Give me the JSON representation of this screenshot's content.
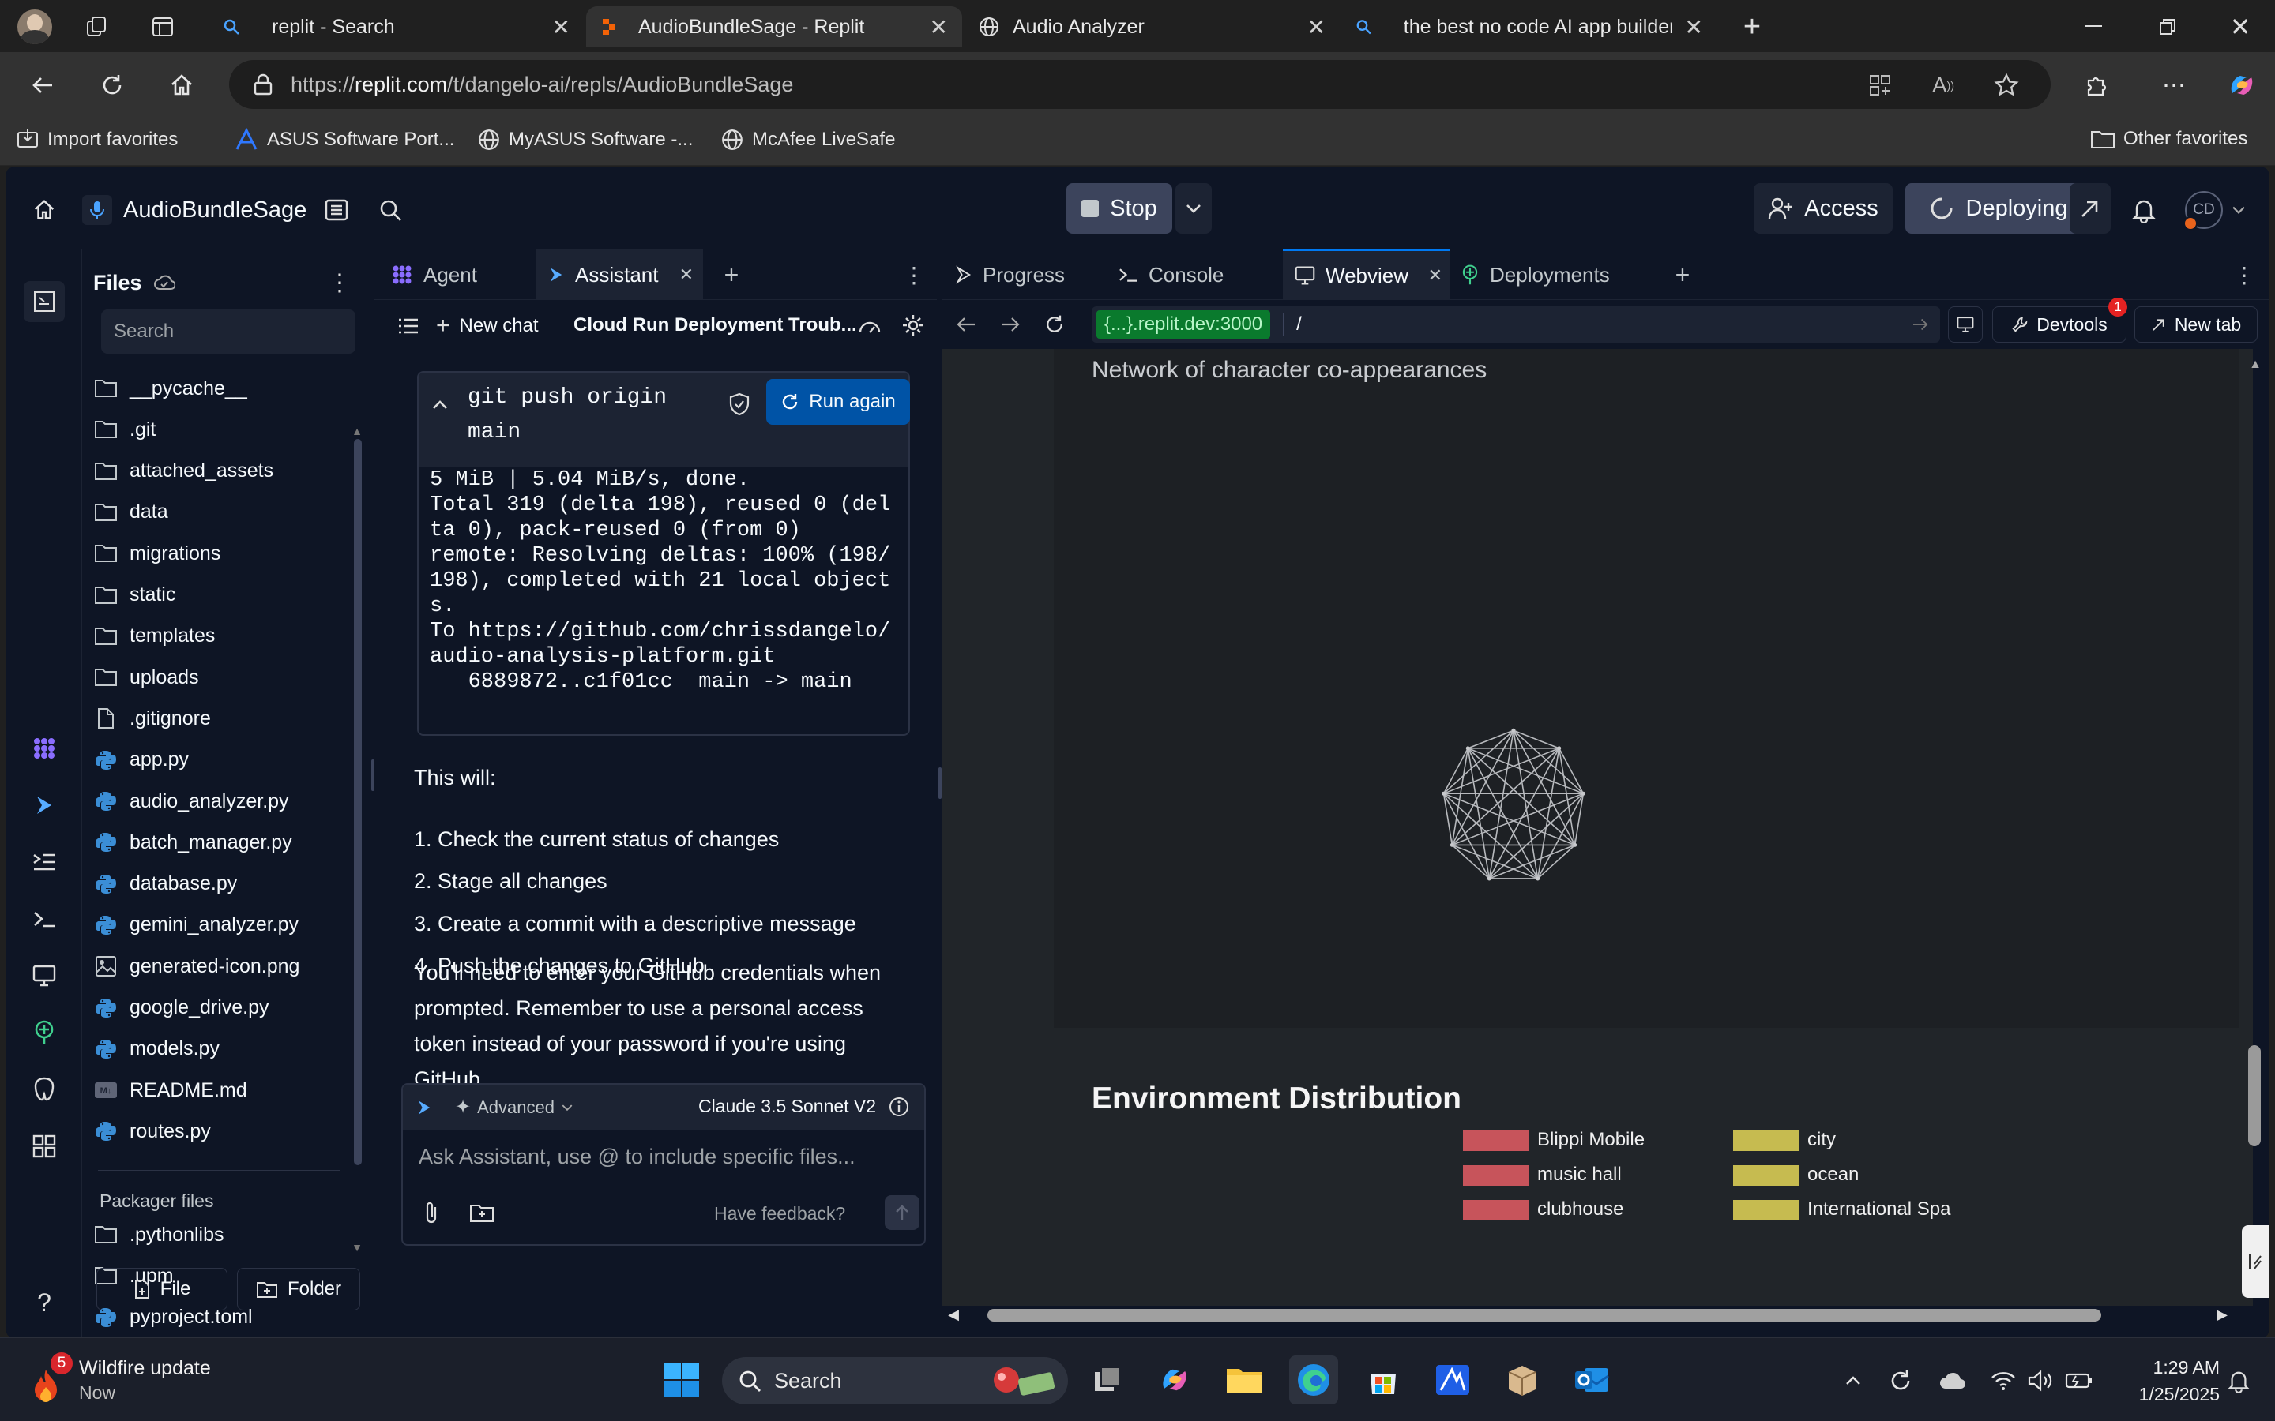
{
  "browser": {
    "tabs": [
      {
        "label": "replit - Search"
      },
      {
        "label": "AudioBundleSage - Replit"
      },
      {
        "label": "Audio Analyzer"
      },
      {
        "label": "the best no code AI app builder -"
      }
    ],
    "url_prefix": "https://",
    "url_host": "replit.com",
    "url_path": "/t/dangelo-ai/repls/AudioBundleSage",
    "favorites": [
      {
        "label": "Import favorites"
      },
      {
        "label": "ASUS Software Port..."
      },
      {
        "label": "MyASUS Software -..."
      },
      {
        "label": "McAfee LiveSafe"
      }
    ],
    "other_favorites": "Other favorites"
  },
  "app": {
    "repl_name": "AudioBundleSage",
    "stop_label": "Stop",
    "access_label": "Access",
    "deploying_label": "Deploying",
    "avatar_initials": "CD"
  },
  "files": {
    "title": "Files",
    "search_placeholder": "Search",
    "items": [
      {
        "name": "__pycache__",
        "icon": "folder"
      },
      {
        "name": ".git",
        "icon": "folder"
      },
      {
        "name": "attached_assets",
        "icon": "folder"
      },
      {
        "name": "data",
        "icon": "folder"
      },
      {
        "name": "migrations",
        "icon": "folder"
      },
      {
        "name": "static",
        "icon": "folder"
      },
      {
        "name": "templates",
        "icon": "folder"
      },
      {
        "name": "uploads",
        "icon": "folder"
      },
      {
        "name": ".gitignore",
        "icon": "file"
      },
      {
        "name": "app.py",
        "icon": "python"
      },
      {
        "name": "audio_analyzer.py",
        "icon": "python"
      },
      {
        "name": "batch_manager.py",
        "icon": "python"
      },
      {
        "name": "database.py",
        "icon": "python"
      },
      {
        "name": "gemini_analyzer.py",
        "icon": "python"
      },
      {
        "name": "generated-icon.png",
        "icon": "image"
      },
      {
        "name": "google_drive.py",
        "icon": "python"
      },
      {
        "name": "models.py",
        "icon": "python"
      },
      {
        "name": "README.md",
        "icon": "markdown"
      },
      {
        "name": "routes.py",
        "icon": "python"
      }
    ],
    "packager_title": "Packager files",
    "packager_items": [
      {
        "name": ".pythonlibs",
        "icon": "folder"
      },
      {
        "name": ".upm",
        "icon": "folder"
      },
      {
        "name": "pyproject.toml",
        "icon": "python"
      }
    ],
    "new_file_label": "File",
    "new_folder_label": "Folder"
  },
  "assistant": {
    "tabs": [
      {
        "label": "Agent"
      },
      {
        "label": "Assistant"
      }
    ],
    "new_chat_label": "New chat",
    "chat_title": "Cloud Run Deployment Troub...",
    "command_line1": "git push origin",
    "command_line2": "main",
    "run_again_label": "Run again",
    "output_lines": [
      "5 MiB | 5.04 MiB/s, done.",
      "Total 319 (delta 198), reused 0 (del",
      "ta 0), pack-reused 0 (from 0)",
      "remote: Resolving deltas: 100% (198/",
      "198), completed with 21 local object",
      "s.",
      "To https://github.com/chrissdangelo/",
      "audio-analysis-platform.git",
      "   6889872..c1f01cc  main -> main"
    ],
    "intro": "This will:",
    "steps": [
      "1. Check the current status of changes",
      "2. Stage all changes",
      "3. Create a commit with a descriptive message",
      "4. Push the changes to GitHub"
    ],
    "note_lines": [
      "You'll need to enter your GitHub credentials when",
      "prompted. Remember to use a personal access",
      "token instead of your password if you're using",
      "GitHub."
    ],
    "mode_label": "Advanced",
    "model_label": "Claude 3.5 Sonnet V2",
    "input_placeholder": "Ask Assistant, use @ to include specific files...",
    "feedback_label": "Have feedback?"
  },
  "webview": {
    "tabs": [
      {
        "label": "Progress"
      },
      {
        "label": "Console"
      },
      {
        "label": "Webview"
      },
      {
        "label": "Deployments"
      }
    ],
    "host_badge": "{...}.replit.dev:3000",
    "path": "/",
    "devtools_label": "Devtools",
    "devtools_badge": "1",
    "new_tab_label": "New tab",
    "network_caption": "Network of character co-appearances",
    "env_title": "Environment Distribution",
    "legend": [
      {
        "label": "Blippi Mobile",
        "color": "#d95a61"
      },
      {
        "label": "city",
        "color": "#d8cc55"
      },
      {
        "label": "music hall",
        "color": "#d95a61"
      },
      {
        "label": "ocean",
        "color": "#d8cc55"
      },
      {
        "label": "clubhouse",
        "color": "#d95a61"
      },
      {
        "label": "International Spa",
        "color": "#d8cc55"
      }
    ]
  },
  "taskbar": {
    "weather_title": "Wildfire update",
    "weather_sub": "Now",
    "weather_badge": "5",
    "search_label": "Search",
    "time": "1:29 AM",
    "date": "1/25/2025"
  }
}
